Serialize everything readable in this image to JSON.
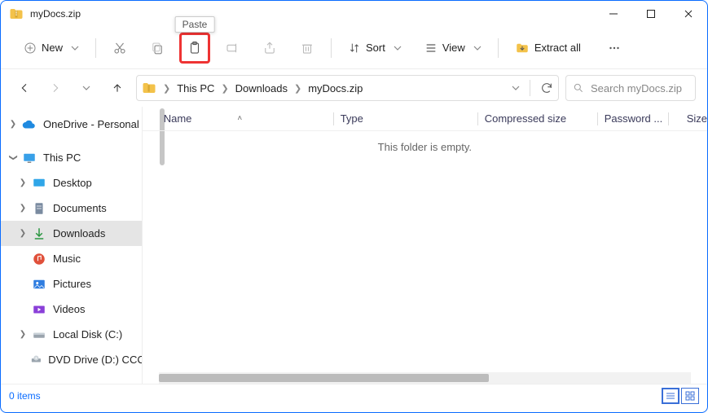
{
  "title": "myDocs.zip",
  "tooltip_paste": "Paste",
  "toolbar": {
    "new_label": "New",
    "sort_label": "Sort",
    "view_label": "View",
    "extract_label": "Extract all"
  },
  "breadcrumb": [
    "This PC",
    "Downloads",
    "myDocs.zip"
  ],
  "search_placeholder": "Search myDocs.zip",
  "sidebar": {
    "items": [
      {
        "label": "OneDrive - Personal"
      },
      {
        "label": "This PC"
      },
      {
        "label": "Desktop"
      },
      {
        "label": "Documents"
      },
      {
        "label": "Downloads"
      },
      {
        "label": "Music"
      },
      {
        "label": "Pictures"
      },
      {
        "label": "Videos"
      },
      {
        "label": "Local Disk (C:)"
      },
      {
        "label": "DVD Drive (D:) CCCOM"
      }
    ]
  },
  "columns": {
    "name": "Name",
    "type": "Type",
    "compressed": "Compressed size",
    "password": "Password ...",
    "size": "Size"
  },
  "empty_message": "This folder is empty.",
  "status": "0 items"
}
